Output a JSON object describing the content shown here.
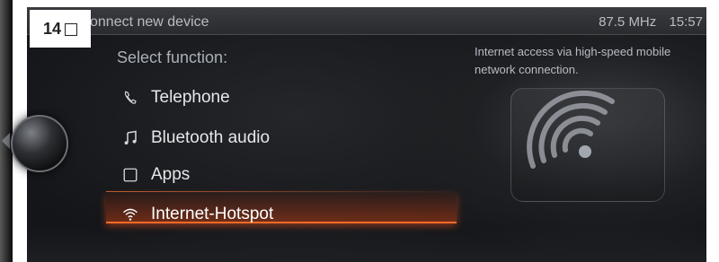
{
  "figure_badge": {
    "number": "14"
  },
  "status_bar": {
    "title": "onnect new device",
    "frequency": "87.5 MHz",
    "time": "15:57"
  },
  "prompt": "Select function:",
  "menu": {
    "items": [
      {
        "label": "Telephone",
        "icon": "telephone-icon",
        "selected": false
      },
      {
        "label": "Bluetooth audio",
        "icon": "music-note-icon",
        "selected": false
      },
      {
        "label": "Apps",
        "icon": "apps-square-icon",
        "selected": false
      },
      {
        "label": "Internet-Hotspot",
        "icon": "wifi-icon",
        "selected": true
      }
    ]
  },
  "description": "Internet access via high-speed mobile network connection.",
  "colors": {
    "accent": "#ff6a2a",
    "background": "#141518",
    "text": "#e6e7e9"
  }
}
